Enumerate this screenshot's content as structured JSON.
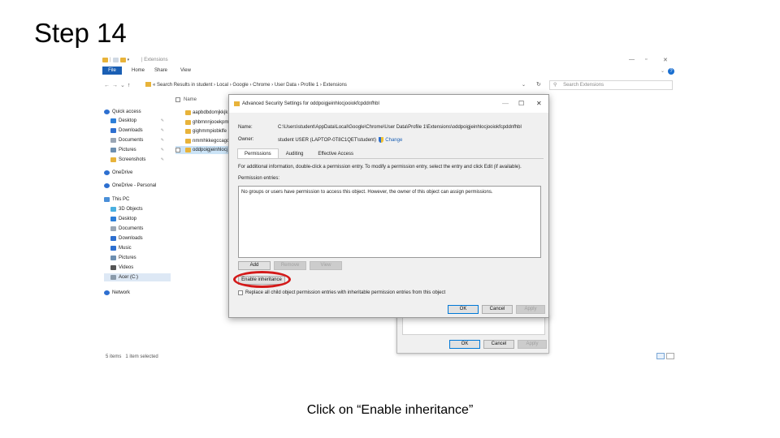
{
  "slide": {
    "title": "Step 14",
    "caption": "Click on “Enable inheritance”"
  },
  "explorer": {
    "title": "Extensions",
    "ribbon": {
      "file": "File",
      "home": "Home",
      "share": "Share",
      "view": "View"
    },
    "address": [
      "Search Results in student",
      "Local",
      "Google",
      "Chrome",
      "User Data",
      "Profile 1",
      "Extensions"
    ],
    "search_placeholder": "Search Extensions",
    "nav_items": [
      {
        "label": "Quick access",
        "icon": "star-icon"
      },
      {
        "label": "Desktop",
        "icon": "desktop-icon",
        "pinned": true
      },
      {
        "label": "Downloads",
        "icon": "download-icon",
        "pinned": true
      },
      {
        "label": "Documents",
        "icon": "document-icon",
        "pinned": true
      },
      {
        "label": "Pictures",
        "icon": "pictures-icon",
        "pinned": true
      },
      {
        "label": "Screenshots",
        "icon": "folder-icon",
        "pinned": true
      },
      {
        "label": "OneDrive",
        "icon": "cloud-icon"
      },
      {
        "label": "OneDrive - Personal",
        "icon": "cloud-icon"
      },
      {
        "label": "This PC",
        "icon": "pc-icon"
      },
      {
        "label": "3D Objects",
        "icon": "cube-icon"
      },
      {
        "label": "Desktop",
        "icon": "desktop-icon"
      },
      {
        "label": "Documents",
        "icon": "document-icon"
      },
      {
        "label": "Downloads",
        "icon": "download-icon"
      },
      {
        "label": "Music",
        "icon": "music-icon"
      },
      {
        "label": "Pictures",
        "icon": "pictures-icon"
      },
      {
        "label": "Videos",
        "icon": "video-icon"
      },
      {
        "label": "Acer (C:)",
        "icon": "drive-icon",
        "selected": true
      },
      {
        "label": "Network",
        "icon": "network-icon"
      }
    ],
    "file_header": "Name",
    "files": [
      "aapbdbdomjkkjk",
      "ghbmnnjooekpm",
      "gighmmpiobklfe",
      "nmmhkkegccagd",
      "oddpoigjeinhlocj"
    ],
    "status": {
      "count": "5 items",
      "selected": "1 item selected"
    }
  },
  "advanced_dialog": {
    "title": "Advanced Security Settings for oddpoigjeinhlocjooiokfcpddnfhbl",
    "name_label": "Name:",
    "name_value": "C:\\Users\\student\\AppData\\Local\\Google\\Chrome\\User Data\\Profile 1\\Extensions\\oddpoigjeinhlocjooiokfcpddnfhbl",
    "owner_label": "Owner:",
    "owner_value": "student USER (LAPTOP-0T8C1QET\\student)",
    "change_link": "Change",
    "tabs": [
      "Permissions",
      "Auditing",
      "Effective Access"
    ],
    "info_text": "For additional information, double-click a permission entry. To modify a permission entry, select the entry and click Edit (if available).",
    "entries_label": "Permission entries:",
    "entries_message": "No groups or users have permission to access this object. However, the owner of this object can assign permissions.",
    "add": "Add",
    "remove": "Remove",
    "view": "View",
    "enable_inheritance": "Enable inheritance",
    "replace_label": "Replace all child object permission entries with inheritable permission entries from this object",
    "ok": "OK",
    "cancel": "Cancel",
    "apply": "Apply"
  },
  "props_dialog": {
    "ok": "OK",
    "cancel": "Cancel",
    "apply": "Apply"
  },
  "colors": {
    "highlight": "#d41a1a",
    "file_tab": "#1a5fb4",
    "folder": "#e8b33a"
  }
}
